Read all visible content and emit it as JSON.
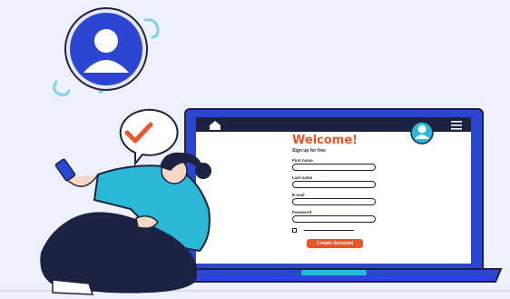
{
  "form": {
    "title": "Welcome!",
    "subtitle": "Sign up for free",
    "fields": [
      {
        "label": "First name"
      },
      {
        "label": "Last name"
      },
      {
        "label": "E-mail"
      },
      {
        "label": "Password"
      }
    ],
    "submit_label": "Create Account"
  },
  "colors": {
    "accent": "#e8562a",
    "laptop": "#2c46d4",
    "ink": "#1c2340",
    "teal": "#29b8d6",
    "background": "#eef0fb"
  },
  "icons": [
    "user-avatar-icon",
    "check-mark-icon",
    "home-icon",
    "hamburger-menu-icon",
    "profile-icon"
  ]
}
